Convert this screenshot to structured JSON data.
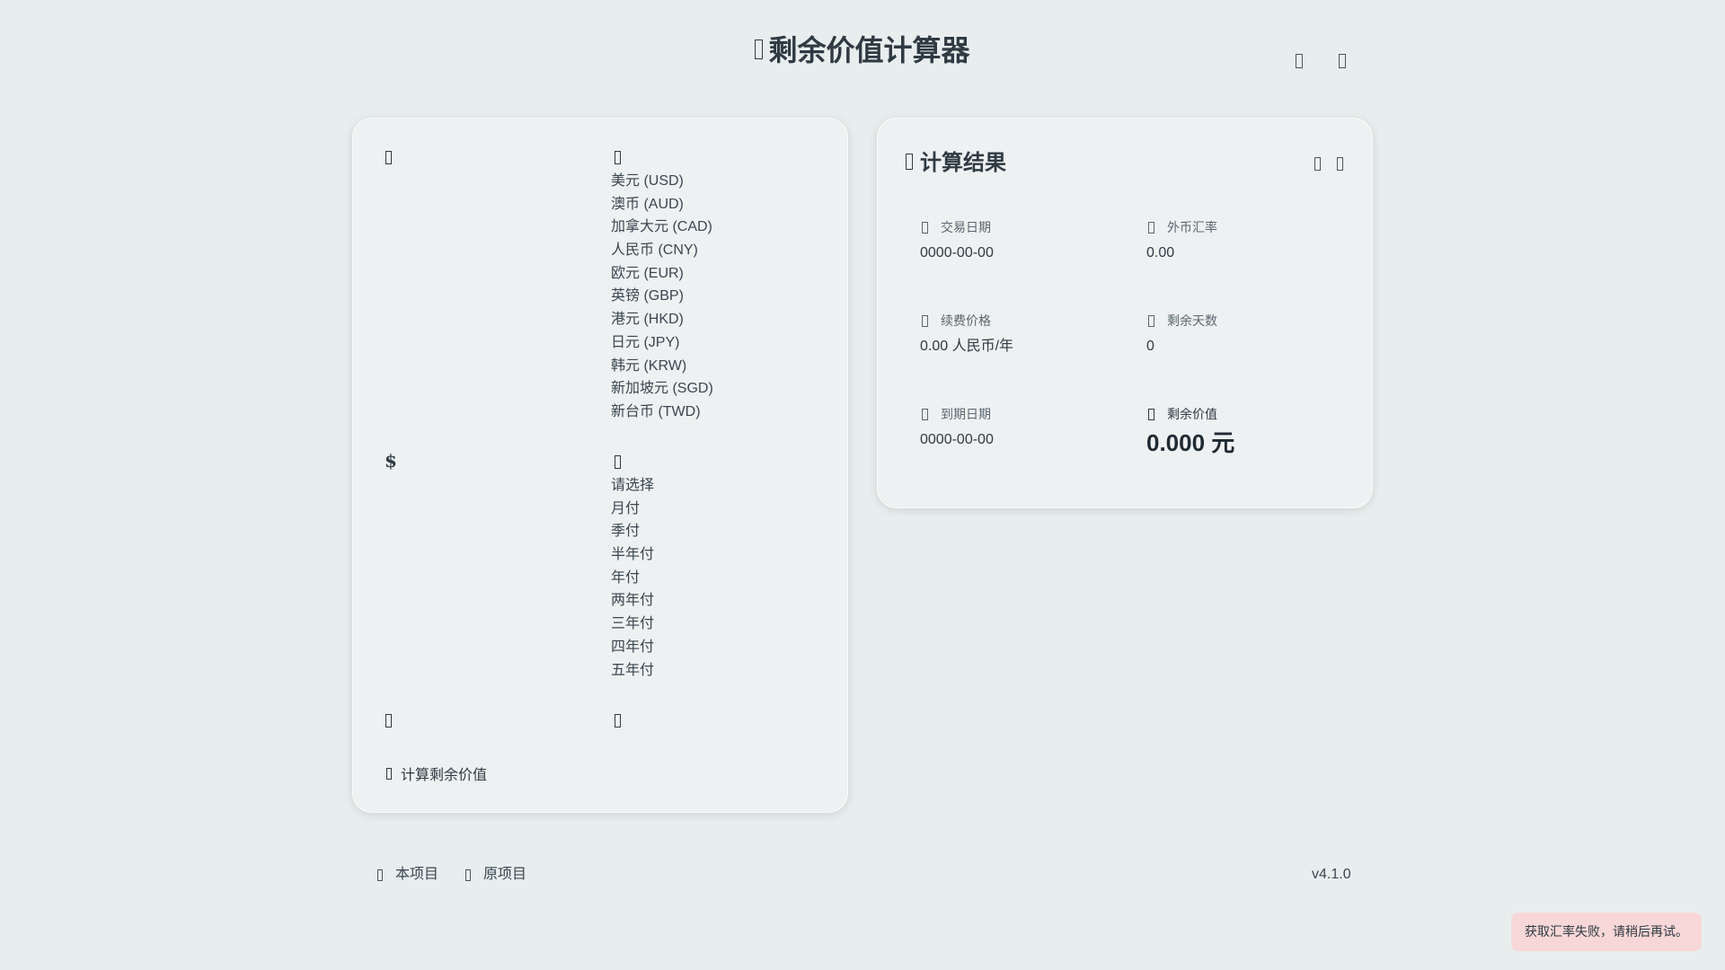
{
  "header": {
    "title": "剩余价值计算器",
    "title_icon": "calculator-icon",
    "actions": [
      {
        "icon": "theme-toggle-icon"
      },
      {
        "icon": "github-icon"
      }
    ]
  },
  "form": {
    "currency": {
      "icon": "coin-icon",
      "select_icon": "chevron-icon",
      "options": [
        "美元 (USD)",
        "澳币 (AUD)",
        "加拿大元 (CAD)",
        "人民币 (CNY)",
        "欧元 (EUR)",
        "英镑 (GBP)",
        "港元 (HKD)",
        "日元 (JPY)",
        "韩元 (KRW)",
        "新加坡元 (SGD)",
        "新台币 (TWD)"
      ]
    },
    "price": {
      "icon_glyph": "$",
      "select_icon": "chevron-icon",
      "options": [
        "请选择",
        "月付",
        "季付",
        "半年付",
        "年付",
        "两年付",
        "三年付",
        "四年付",
        "五年付"
      ]
    },
    "dates": {
      "left_icon": "calendar-icon",
      "right_icon": "calendar-check-icon"
    },
    "calculate_label": "计算剩余价值",
    "calculate_icon": "calculator-icon"
  },
  "result": {
    "title": "计算结果",
    "title_icon": "chart-icon",
    "actions": [
      {
        "icon": "copy-icon"
      },
      {
        "icon": "share-icon"
      }
    ],
    "stats": [
      {
        "label": "交易日期",
        "value": "0000-00-00",
        "icon": "calendar-icon"
      },
      {
        "label": "外币汇率",
        "value": "0.00",
        "icon": "exchange-icon"
      },
      {
        "label": "续费价格",
        "value": "0.00 人民币/年",
        "icon": "tag-icon"
      },
      {
        "label": "剩余天数",
        "value": "0",
        "icon": "hourglass-icon"
      },
      {
        "label": "到期日期",
        "value": "0000-00-00",
        "icon": "calendar-x-icon"
      },
      {
        "label": "剩余价值",
        "value": "0.000 元",
        "icon": "wallet-icon"
      }
    ]
  },
  "footer": {
    "links": [
      {
        "label": "本项目",
        "icon": "github-icon"
      },
      {
        "label": "原项目",
        "icon": "code-icon"
      }
    ],
    "version": "v4.1.0"
  },
  "toast": {
    "message": "获取汇率失败，请稍后再试。"
  }
}
